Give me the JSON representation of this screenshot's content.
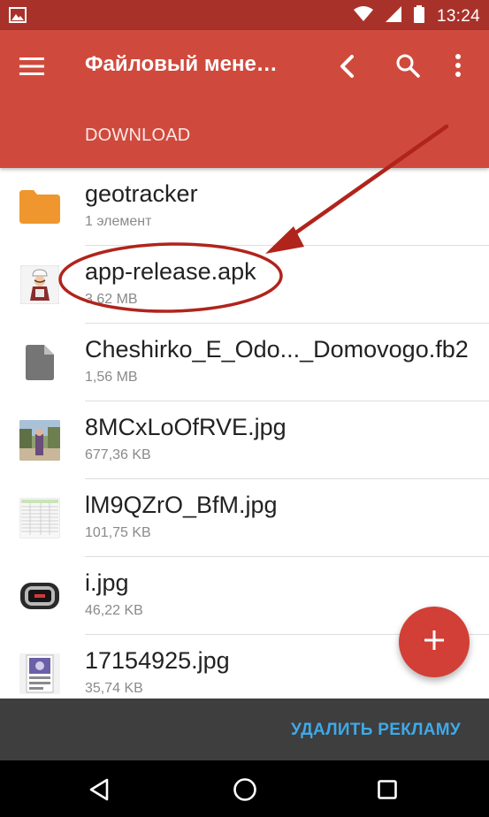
{
  "status_bar": {
    "time": "13:24",
    "icons": [
      "image-notification-icon",
      "wifi-icon",
      "cellular-signal-icon",
      "battery-icon"
    ]
  },
  "app_bar": {
    "title": "Файловый мене…",
    "breadcrumb": "DOWNLOAD",
    "icons": [
      "menu-icon",
      "back-arrow-icon",
      "search-icon",
      "more-vert-icon"
    ]
  },
  "files": [
    {
      "name": "geotracker",
      "meta": "1 элемент",
      "type": "folder"
    },
    {
      "name": "app-release.apk",
      "meta": "3,62 MB",
      "type": "apk"
    },
    {
      "name": "Cheshirko_E_Odo..._Domovogo.fb2",
      "meta": "1,56 MB",
      "type": "document"
    },
    {
      "name": "8MCxLoOfRVE.jpg",
      "meta": "677,36 KB",
      "type": "image-photo"
    },
    {
      "name": "lM9QZrO_BfM.jpg",
      "meta": "101,75 KB",
      "type": "image-table"
    },
    {
      "name": "i.jpg",
      "meta": "46,22 KB",
      "type": "image-device"
    },
    {
      "name": "17154925.jpg",
      "meta": "35,74 KB",
      "type": "image-poster"
    }
  ],
  "fab": {
    "icon": "add-icon"
  },
  "ad_bar": {
    "remove_ad_label": "УДАЛИТЬ РЕКЛАМУ"
  },
  "nav_bar": {
    "icons": [
      "nav-back-icon",
      "nav-home-icon",
      "nav-recents-icon"
    ]
  },
  "colors": {
    "status_bar": "#a8322a",
    "app_bar": "#cf4a3d",
    "fab": "#d13f36",
    "folder": "#f0962e",
    "remove_ad": "#3fa9e8",
    "annotation": "#b0241c"
  }
}
